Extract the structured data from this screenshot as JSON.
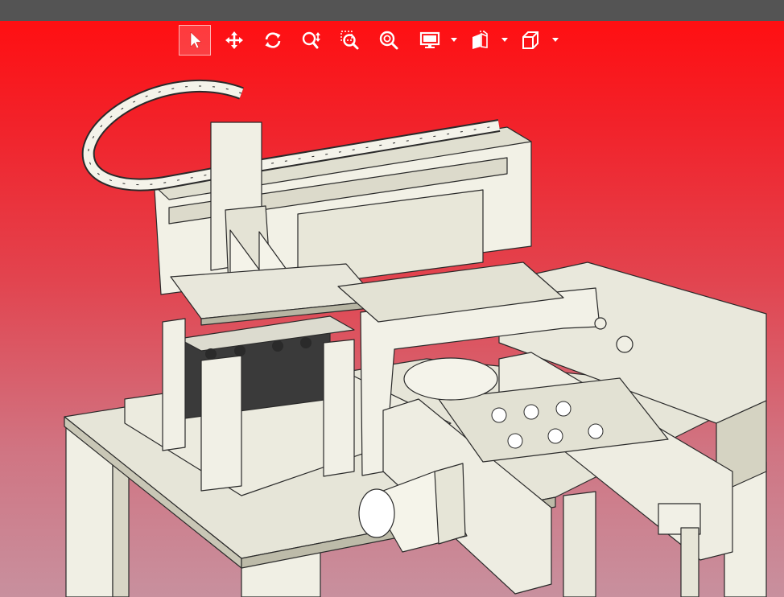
{
  "toolbar": {
    "buttons": [
      {
        "name": "select-tool",
        "icon": "cursor-arrow-icon",
        "active": true
      },
      {
        "name": "pan-tool",
        "icon": "move-arrows-icon"
      },
      {
        "name": "rotate-tool",
        "icon": "rotate-icon"
      },
      {
        "name": "zoom-tool",
        "icon": "zoom-updown-icon"
      },
      {
        "name": "zoom-window-tool",
        "icon": "zoom-window-icon"
      },
      {
        "name": "zoom-fit-tool",
        "icon": "zoom-fit-icon"
      },
      {
        "name": "display-mode-menu",
        "icon": "monitor-icon",
        "dropdown": true
      },
      {
        "name": "section-view-menu",
        "icon": "section-plane-icon",
        "dropdown": true
      },
      {
        "name": "view-orientation-menu",
        "icon": "cube-view-icon",
        "dropdown": true
      }
    ]
  },
  "colors": {
    "titlebar": "#545454",
    "viewport_top": "#ff0f12",
    "viewport_bottom": "#c8909e",
    "model_fill": "#f0efe4",
    "model_shade": "#d8d6c6",
    "model_line": "#2a2a2a",
    "icon": "#ffffff"
  }
}
